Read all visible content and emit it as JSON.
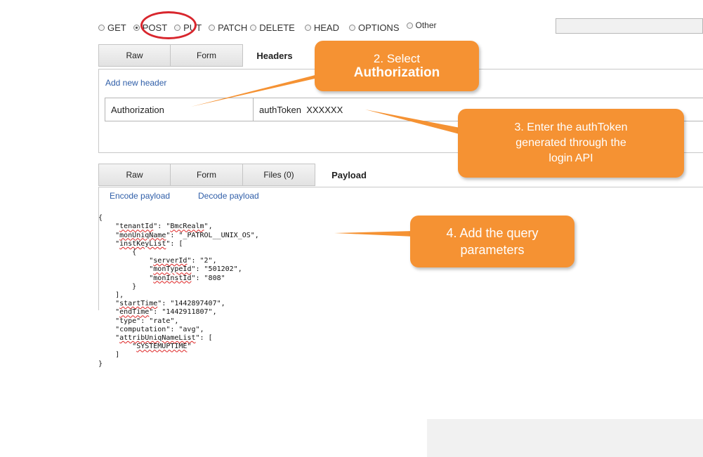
{
  "methods": [
    {
      "label": "GET",
      "checked": false
    },
    {
      "label": "POST",
      "checked": true
    },
    {
      "label": "PUT",
      "checked": false
    },
    {
      "label": "PATCH",
      "checked": false
    },
    {
      "label": "DELETE",
      "checked": false
    },
    {
      "label": "HEAD",
      "checked": false
    },
    {
      "label": "OPTIONS",
      "checked": false
    },
    {
      "label": "Other",
      "checked": false
    }
  ],
  "headers_tabs": {
    "raw": "Raw",
    "form": "Form",
    "headers": "Headers"
  },
  "headers_panel": {
    "add_link": "Add new header",
    "name_value": "Authorization",
    "value_value": "authToken  XXXXXX"
  },
  "payload_tabs": {
    "raw": "Raw",
    "form": "Form",
    "files": "Files (0)",
    "payload": "Payload"
  },
  "payload_links": {
    "encode": "Encode payload",
    "decode": "Decode payload"
  },
  "payload_lines": [
    "{",
    "    \"tenantId\": \"BmcRealm\",",
    "    \"monUniqName\": \"_PATROL__UNIX_OS\",",
    "    \"instKeyList\": [",
    "        {",
    "            \"serverId\": \"2\",",
    "            \"monTypeId\": \"501202\",",
    "            \"monInstId\": \"808\"",
    "        }",
    "    ],",
    "    \"startTime\": \"1442897407\",",
    "    \"endTime\": \"1442911807\",",
    "    \"type\": \"rate\",",
    "    \"computation\": \"avg\",",
    "    \"attribUniqNameList\": [",
    "        \"SYSTEMUPTIME\"",
    "    ]",
    "}"
  ],
  "callouts": {
    "c2_line1": "2. Select",
    "c2_line2": "Authorization",
    "c3_line1": "3. Enter the authToken",
    "c3_line2": "generated through the",
    "c3_line3": "login API",
    "c4_line1": "4. Add the query",
    "c4_line2": "parameters"
  },
  "colors": {
    "callout": "#f59233",
    "highlight_circle": "#d8262d",
    "link": "#2f5ea8"
  }
}
